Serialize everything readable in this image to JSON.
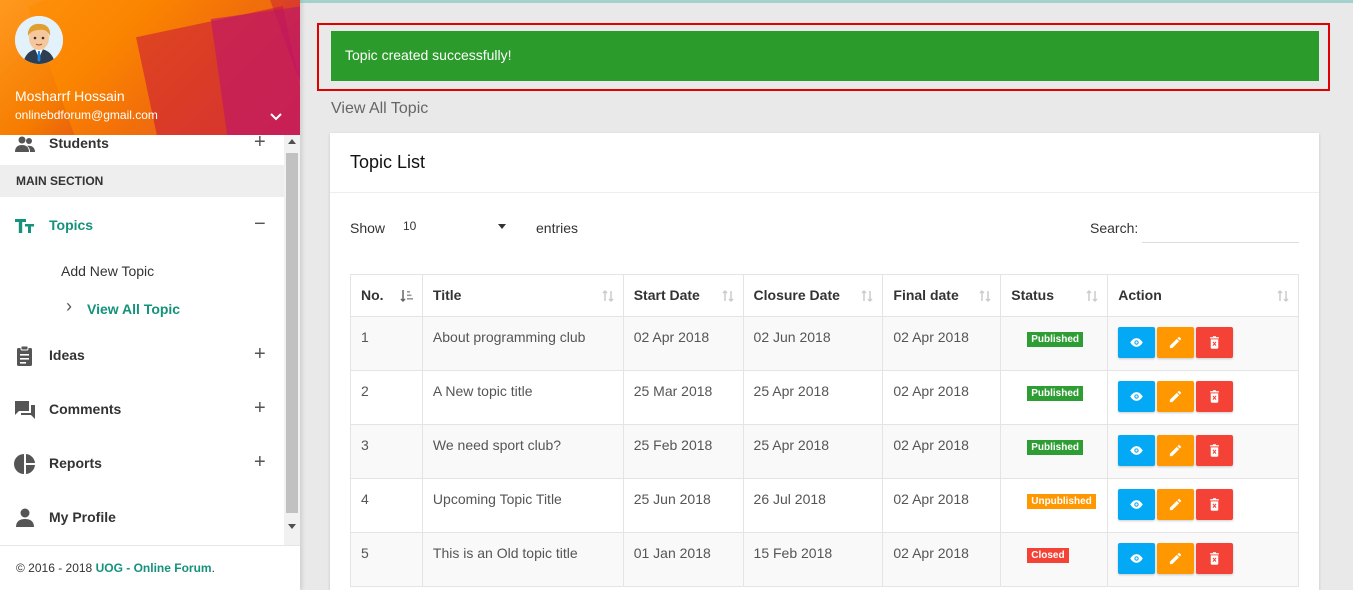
{
  "user": {
    "name": "Mosharrf Hossain",
    "email": "onlinebdforum@gmail.com"
  },
  "sidebar": {
    "students_label": "Students",
    "section_header": "MAIN SECTION",
    "topics_label": "Topics",
    "topics_sign": "−",
    "submenu": {
      "add_new": "Add New Topic",
      "view_all": "View All Topic",
      "chevron": "›"
    },
    "items": [
      {
        "label": "Ideas",
        "sign": "+"
      },
      {
        "label": "Comments",
        "sign": "+"
      },
      {
        "label": "Reports",
        "sign": "+"
      },
      {
        "label": "My Profile"
      }
    ],
    "students_sign": "+"
  },
  "footer": {
    "prefix": "© 2016 - 2018 ",
    "brand": "UOG - Online Forum",
    "suffix": "."
  },
  "alert": {
    "message": "Topic created successfully!",
    "color": "#2b9b2b"
  },
  "page": {
    "title": "View All Topic"
  },
  "card": {
    "title": "Topic List",
    "show_label": "Show",
    "entries_value": "10",
    "entries_label": "entries",
    "search_label": "Search:",
    "search_value": ""
  },
  "table": {
    "headers": [
      "No.",
      "Title",
      "Start Date",
      "Closure Date",
      "Final date",
      "Status",
      "Action"
    ],
    "rows": [
      {
        "no": "1",
        "title": "About programming club",
        "start": "02 Apr 2018",
        "closure": "02 Jun 2018",
        "final": "02 Apr 2018",
        "status": "Published"
      },
      {
        "no": "2",
        "title": "A New topic title",
        "start": "25 Mar 2018",
        "closure": "25 Apr 2018",
        "final": "02 Apr 2018",
        "status": "Published"
      },
      {
        "no": "3",
        "title": "We need sport club?",
        "start": "25 Feb 2018",
        "closure": "25 Apr 2018",
        "final": "02 Apr 2018",
        "status": "Published"
      },
      {
        "no": "4",
        "title": "Upcoming Topic Title",
        "start": "25 Jun 2018",
        "closure": "26 Jul 2018",
        "final": "02 Apr 2018",
        "status": "Unpublished"
      },
      {
        "no": "5",
        "title": "This is an Old topic title",
        "start": "01 Jan 2018",
        "closure": "15 Feb 2018",
        "final": "02 Apr 2018",
        "status": "Closed"
      }
    ]
  },
  "status_colors": {
    "Published": "#2e9d33",
    "Unpublished": "#ff9800",
    "Closed": "#f44336"
  },
  "icons": {
    "view": "eye-icon",
    "edit": "pencil-icon",
    "delete": "trash-icon"
  }
}
